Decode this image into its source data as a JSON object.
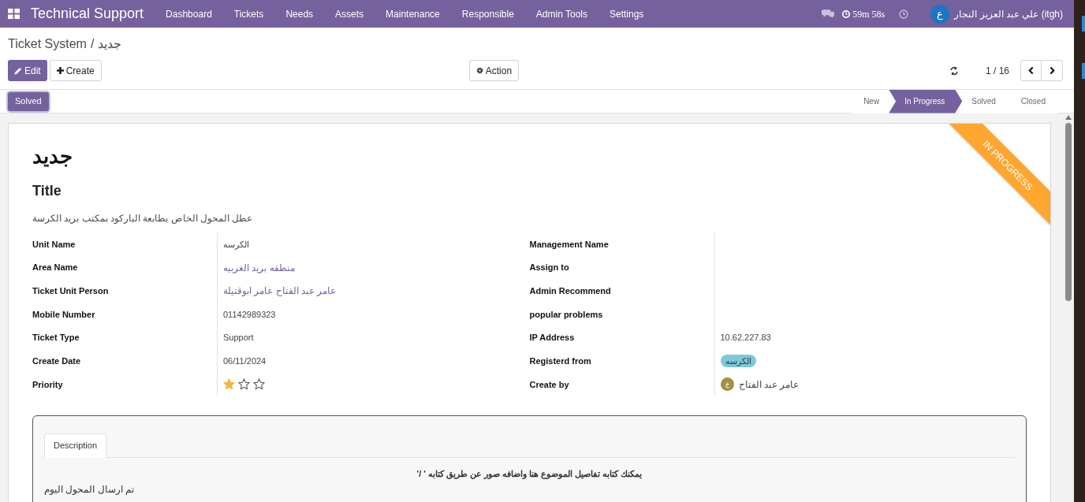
{
  "navbar": {
    "app_title": "Technical Support",
    "menus": [
      "Dashboard",
      "Tickets",
      "Needs",
      "Assets",
      "Maintenance",
      "Responsible",
      "Admin Tools",
      "Settings"
    ],
    "timer": "59m 58s",
    "user_avatar": "ع",
    "user_name": "علي عبد العزيز النجار (itgh)"
  },
  "breadcrumb": {
    "items": [
      "Ticket System",
      "جديد"
    ],
    "separator": "/"
  },
  "buttons": [
    {
      "label": "Edit",
      "kind": "primary"
    },
    {
      "label": "Create",
      "kind": "create"
    }
  ],
  "action_button": "Action",
  "pager": "1 / 16",
  "header_button": "Solved",
  "stages": [
    {
      "label": "New",
      "selected": false
    },
    {
      "label": "In Progress",
      "selected": true
    },
    {
      "label": "Solved",
      "selected": false
    },
    {
      "label": "Closed",
      "selected": false
    }
  ],
  "sheet": {
    "ribbon": "IN PROGRESS",
    "name": "جديد",
    "title_label": "Title",
    "title_value": "عطل المحول الخاص بطابعة الباركود بمكتب بريد الكرسة",
    "left_fields": [
      {
        "label": "Unit Name",
        "kind": "text",
        "value": "الكرسه"
      },
      {
        "label": "Area Name",
        "kind": "link",
        "value": "منطقه بريد الغربيه"
      },
      {
        "label": "Ticket Unit Person",
        "kind": "link",
        "value": "عامر عبد الفتاح عامر ابوقتيلة"
      },
      {
        "label": "Mobile Number",
        "kind": "text",
        "value": "01142989323"
      },
      {
        "label": "Ticket Type",
        "kind": "text",
        "value": "Support"
      },
      {
        "label": "Create Date",
        "kind": "text",
        "value": "06/11/2024"
      },
      {
        "label": "Priority",
        "kind": "stars",
        "stars": 1
      }
    ],
    "right_fields": [
      {
        "label": "Management Name",
        "kind": "empty"
      },
      {
        "label": "Assign to",
        "kind": "empty"
      },
      {
        "label": "Admin Recommend",
        "kind": "empty"
      },
      {
        "label": "popular problems",
        "kind": "empty"
      },
      {
        "label": "IP Address",
        "kind": "text",
        "value": "10.62.227.83"
      },
      {
        "label": "Registerd from",
        "kind": "tag",
        "value": "الكرسه"
      },
      {
        "label": "Create by",
        "kind": "user",
        "avatar": "ع",
        "value": "عامر عبد الفتاح"
      }
    ]
  },
  "notebook": {
    "tabs": [
      {
        "label": "Description",
        "selected": true
      }
    ],
    "hint": "يمكنك كتابه تفاصيل الموضوع هنا واضافه صور عن طريق كتابه ' /'",
    "body": "تم ارسال المحول اليوم"
  }
}
